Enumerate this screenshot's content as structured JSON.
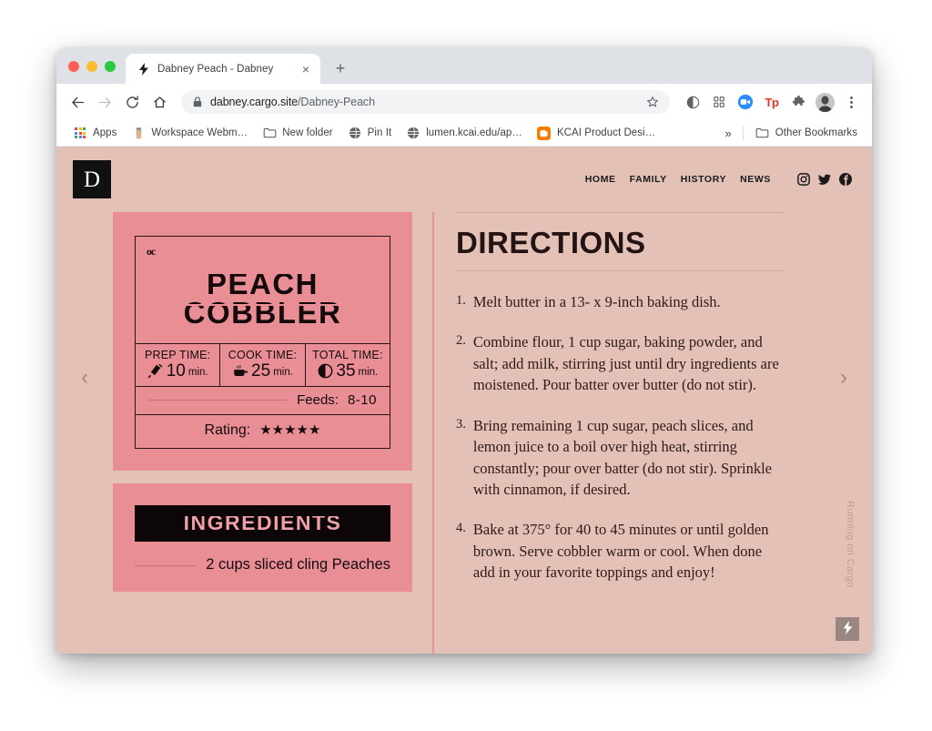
{
  "browser": {
    "tab": {
      "title": "Dabney Peach - Dabney",
      "favicon_name": "bolt-icon",
      "close_label": "×"
    },
    "new_tab_label": "+",
    "toolbar": {
      "back_label": "←",
      "forward_label": "→",
      "reload_label": "⟳",
      "home_label": "⌂",
      "lock_name": "lock-icon",
      "url_host": "dabney.cargo.site",
      "url_path": "/Dabney-Peach",
      "star_label": "☆",
      "extensions": [
        {
          "name": "circle-icon",
          "label": ""
        },
        {
          "name": "grid-apps-icon",
          "label": ""
        },
        {
          "name": "zoom-camera-icon",
          "label": ""
        },
        {
          "name": "tp-extension-icon",
          "label": "Tp"
        },
        {
          "name": "puzzle-extension-icon",
          "label": ""
        },
        {
          "name": "profile-avatar",
          "label": ""
        },
        {
          "name": "kebab-menu-icon",
          "label": ""
        }
      ]
    },
    "bookmarks": [
      {
        "label": "Apps",
        "icon": "apps-grid-icon"
      },
      {
        "label": "Workspace Webm…",
        "icon": "workspace-icon"
      },
      {
        "label": "New folder",
        "icon": "folder-icon"
      },
      {
        "label": "Pin It",
        "icon": "globe-icon"
      },
      {
        "label": "lumen.kcai.edu/ap…",
        "icon": "globe-icon"
      },
      {
        "label": "KCAI Product Desi…",
        "icon": "blogger-icon"
      }
    ],
    "bookmarks_overflow_label": "»",
    "other_bookmarks_label": "Other Bookmarks",
    "other_bookmarks_icon": "folder-icon"
  },
  "site": {
    "logo_letter": "D",
    "nav": [
      {
        "label": "HOME"
      },
      {
        "label": "FAMILY"
      },
      {
        "label": "HISTORY"
      },
      {
        "label": "NEWS"
      }
    ],
    "social": [
      {
        "name": "instagram-icon"
      },
      {
        "name": "twitter-icon"
      },
      {
        "name": "facebook-icon"
      }
    ],
    "prev_arrow": "‹",
    "next_arrow": "›",
    "cargo_label": "Running on Cargo",
    "cargo_badge_icon": "lightning-bolt-icon"
  },
  "recipe": {
    "deco_mark": "oc",
    "title_line1": "PEACH",
    "title_line2": "COBBLER",
    "times": [
      {
        "label": "PREP TIME:",
        "icon": "whisk-icon",
        "value": "10",
        "unit": "min."
      },
      {
        "label": "COOK TIME:",
        "icon": "steaming-pot-icon",
        "value": "25",
        "unit": "min."
      },
      {
        "label": "TOTAL TIME:",
        "icon": "half-clock-icon",
        "value": "35",
        "unit": "min."
      }
    ],
    "feeds_label": "Feeds:",
    "feeds_value": "8-10",
    "rating_label": "Rating:",
    "rating_stars": "★★★★★",
    "rating_count": 5,
    "ingredients_title": "INGREDIENTS",
    "ingredients": [
      {
        "text": "2 cups sliced cling Peaches"
      }
    ]
  },
  "directions": {
    "title": "DIRECTIONS",
    "steps": [
      {
        "num": "1.",
        "text": "Melt butter in a 13- x 9-inch baking dish."
      },
      {
        "num": "2.",
        "text": "Combine flour, 1 cup sugar, baking powder, and salt; add milk, stirring just until dry ingredients are moistened. Pour batter over butter (do not stir)."
      },
      {
        "num": "3.",
        "text": "Bring remaining 1 cup sugar, peach slices, and lemon juice to a boil over high heat, stirring constantly; pour over batter (do not stir). Sprinkle with cinnamon, if desired."
      },
      {
        "num": "4.",
        "text": "Bake at 375° for 40 to 45 minutes or until golden brown. Serve cobbler warm or cool. When done add in your favorite toppings and enjoy!"
      }
    ]
  },
  "colors": {
    "page_background": "#e3c1b7",
    "card_pink": "#ea8e96",
    "ink": "#140a0c",
    "rule": "#cfa79c",
    "cargo_gray": "#9b8781"
  }
}
